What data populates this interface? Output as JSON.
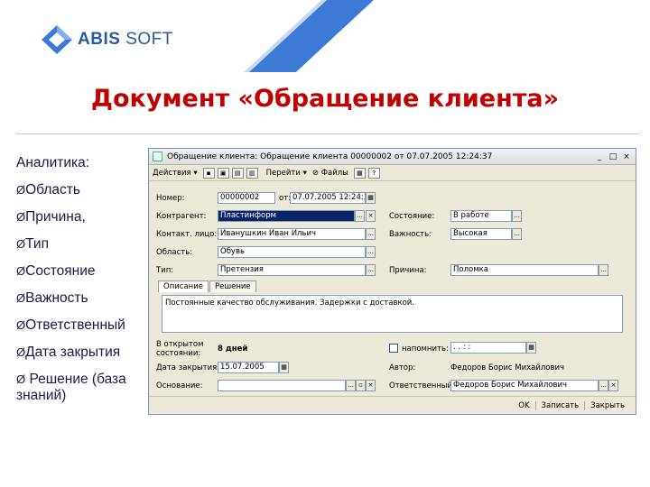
{
  "logo": {
    "brand_bold": "ABIS",
    "brand_light": "SOFT"
  },
  "slide_title": "Документ «Обращение клиента»",
  "left_panel": {
    "heading": "Аналитика:",
    "items": [
      "Область",
      "Причина,",
      "Тип",
      "Состояние",
      "Важность",
      "Ответственный",
      "Дата закрытия",
      "Решение (база знаний)"
    ]
  },
  "window": {
    "title": "Обращение клиента: Обращение клиента 00000002 от 07.07.2005 12:24:37",
    "controls": [
      "_",
      "□",
      "×"
    ],
    "toolbar": {
      "actions": "Действия",
      "goto": "Перейти",
      "files": "Файлы"
    },
    "fields": {
      "number_label": "Номер:",
      "number_value": "00000002",
      "from_label": "от:",
      "date_value": "07.07.2005 12:24:37",
      "counterparty_label": "Контрагент:",
      "counterparty_value": "Пластинформ",
      "contact_label": "Контакт. лицо:",
      "contact_value": "Иванушкин Иван Ильич",
      "area_label": "Область:",
      "area_value": "Обувь",
      "type_label": "Тип:",
      "type_value": "Претензия",
      "state_label": "Состояние:",
      "state_value": "В работе",
      "importance_label": "Важность:",
      "importance_value": "Высокая",
      "reason_label": "Причина:",
      "reason_value": "Поломка",
      "open_label_1": "В открытом",
      "open_label_2": "состоянии:",
      "open_value": "8 дней",
      "remind_label": "напомнить:",
      "remind_value": ". .   :  :",
      "close_date_label": "Дата закрытия:",
      "close_date_value": "15.07.2005",
      "author_label": "Автор:",
      "author_value": "Федоров Борис Михайлович",
      "basis_label": "Основание:",
      "basis_value": "",
      "responsible_label": "Ответственный:",
      "responsible_value": "Федоров Борис Михайлович"
    },
    "tabs": [
      "Описание",
      "Решение"
    ],
    "description_text": "Постоянные качество обслуживания. Задержки с доставкой.",
    "bottom_buttons": [
      "OK",
      "Записать",
      "Закрыть"
    ]
  },
  "colors": {
    "title_red": "#c00000",
    "brand_blue": "#2a5aa0",
    "stripe_blue": "#3c7ad6"
  }
}
